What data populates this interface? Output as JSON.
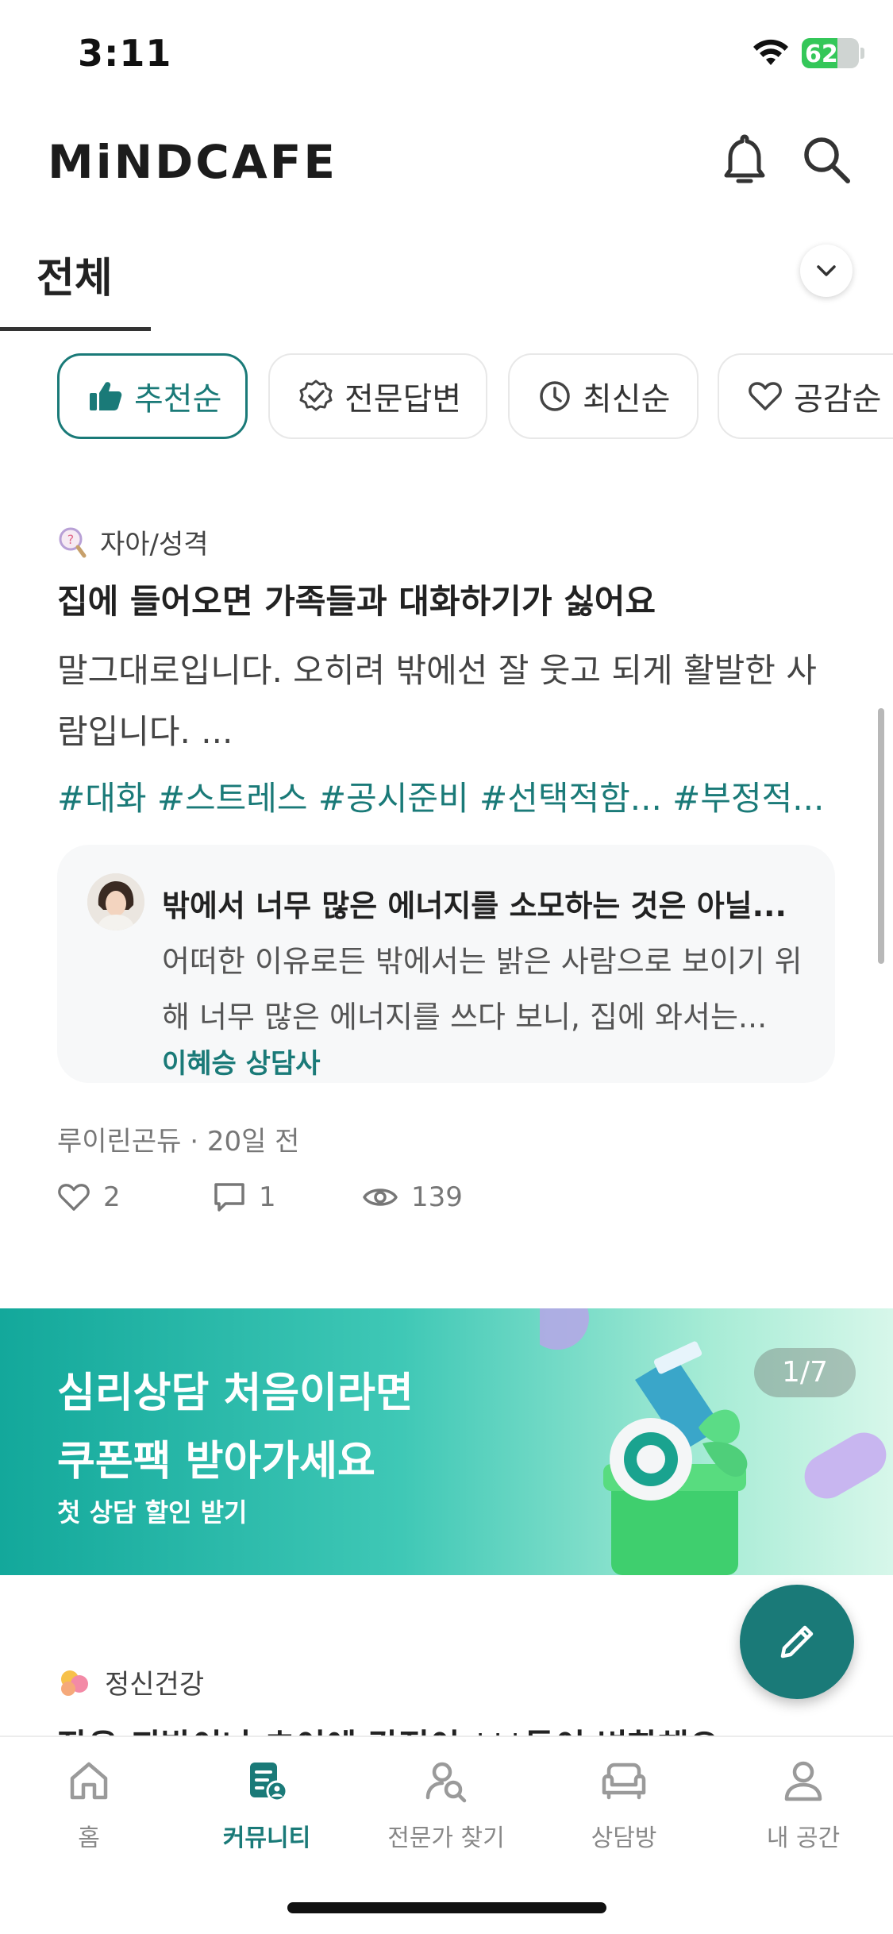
{
  "status_bar": {
    "time": "3:11",
    "battery": "62",
    "battery_level": 0.62
  },
  "header": {
    "logo": "MiNDCAFE"
  },
  "category_tabs": {
    "selected": "전체"
  },
  "filter_chips": [
    {
      "label": "추천순",
      "icon": "thumbs-up-icon",
      "active": true
    },
    {
      "label": "전문답변",
      "icon": "verified-badge-icon",
      "active": false
    },
    {
      "label": "최신순",
      "icon": "clock-icon",
      "active": false
    },
    {
      "label": "공감순",
      "icon": "heart-icon",
      "active": false
    }
  ],
  "post": {
    "category": "자아/성격",
    "title": "집에 들어오면 가족들과 대화하기가 싫어요",
    "body": "말그대로입니다. 오히려 밖에선 잘 웃고 되게 활발한 사람입니다. ...",
    "tags": "#대화 #스트레스 #공시준비 #선택적함... #부정적...",
    "answer": {
      "title": "밖에서 너무 많은 에너지를 소모하는 것은 아닐...",
      "body": "어떠한 이유로든 밖에서는 밝은 사람으로 보이기 위해 너무 많은 에너지를 쓰다 보니, 집에 와서는...",
      "author": "이혜승 상담사"
    },
    "meta": "루이린곤듀 · 20일 전",
    "likes": "2",
    "comments": "1",
    "views": "139"
  },
  "banner": {
    "line1": "심리상담 처음이라면",
    "line2": "쿠폰팩 받아가세요",
    "subtitle": "첫 상담 할인 받기",
    "counter": "1/7"
  },
  "post2": {
    "category": "정신건강",
    "title": "잦은 퇴발이나 초이에 감정이 ***들이 변화해요"
  },
  "bottom_nav": [
    {
      "label": "홈",
      "icon": "home-icon",
      "active": false
    },
    {
      "label": "커뮤니티",
      "icon": "community-icon",
      "active": true
    },
    {
      "label": "전문가 찾기",
      "icon": "find-expert-icon",
      "active": false
    },
    {
      "label": "상담방",
      "icon": "sofa-icon",
      "active": false
    },
    {
      "label": "내 공간",
      "icon": "person-icon",
      "active": false
    }
  ],
  "colors": {
    "accent": "#1a7a78",
    "banner_start": "#13a89b",
    "banner_end": "#d7f7ea"
  }
}
